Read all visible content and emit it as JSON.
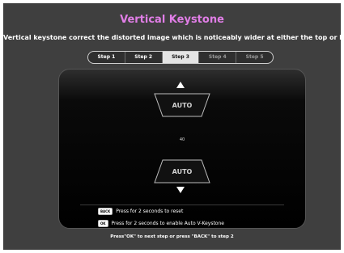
{
  "header": {
    "title": "Vertical Keystone",
    "description": "Vertical keystone correct the distorted image which is noticeably wider at either the top or bottom"
  },
  "steps": {
    "items": [
      "Step 1",
      "Step 2",
      "Step 3",
      "Step 4",
      "Step 5"
    ],
    "active_index": 2
  },
  "keystone": {
    "top_label": "AUTO",
    "value": "40",
    "bottom_label": "AUTO"
  },
  "hints": {
    "reset_key": "BACK",
    "reset_text": "Press for 2 seconds to reset",
    "auto_key": "OK",
    "auto_text": "Press for 2 seconds to enable Auto V-Keystone"
  },
  "footer": {
    "text": "Press\"OK\" to next step or press \"BACK\" to step 2"
  },
  "colors": {
    "title": "#e07ee6",
    "background": "#3f3f3f",
    "active_step": "#e4e4e4"
  }
}
